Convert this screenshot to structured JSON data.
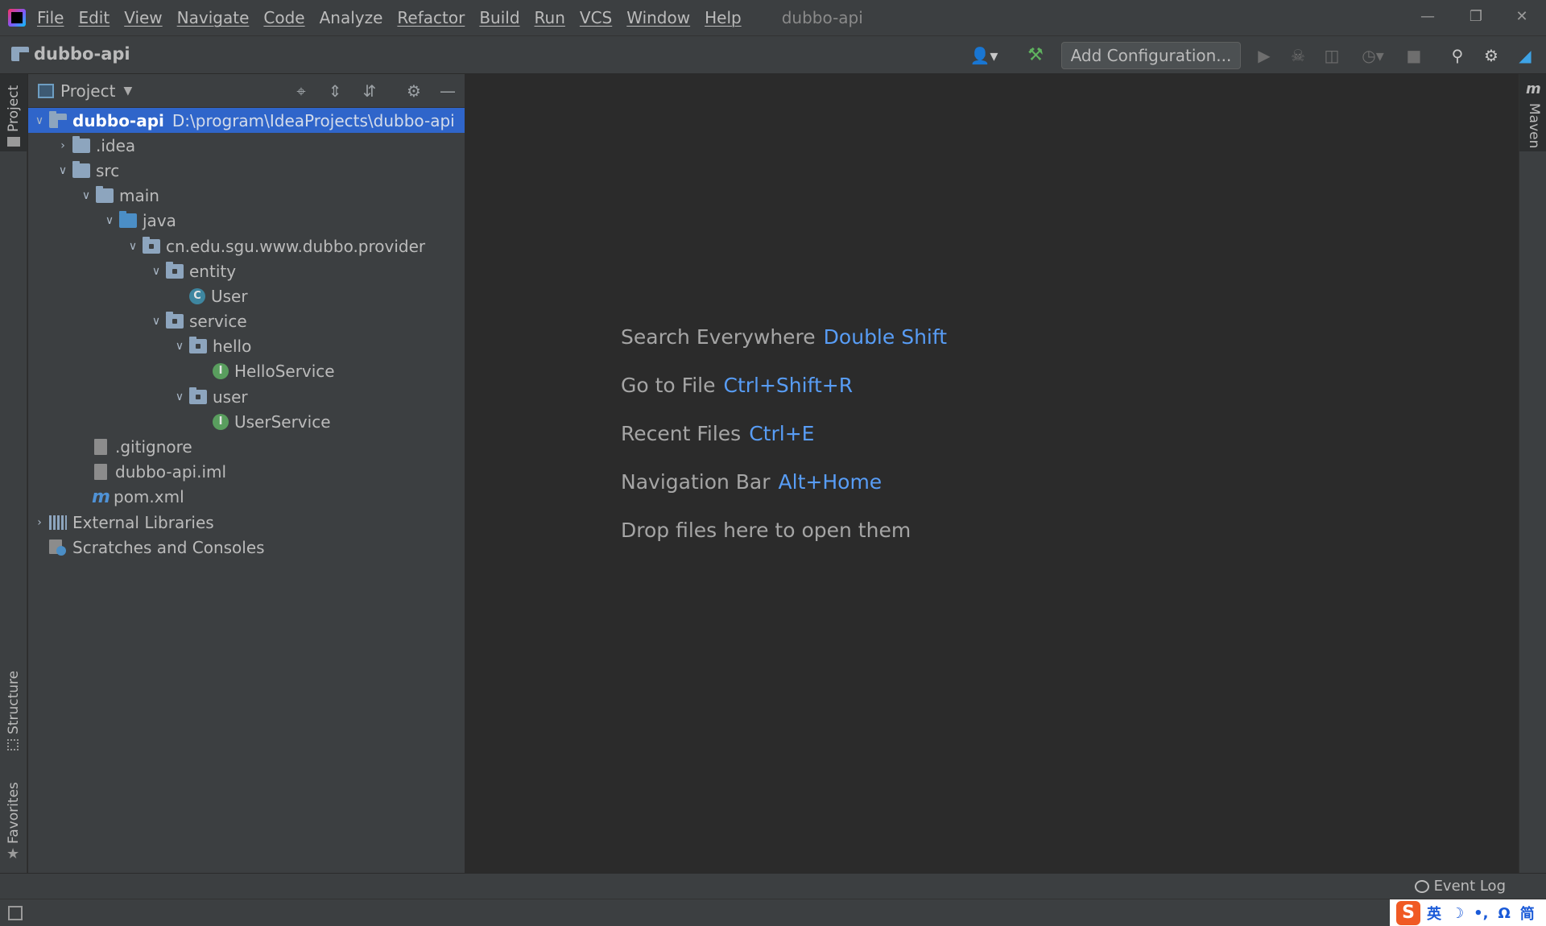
{
  "menu": {
    "items": [
      "File",
      "Edit",
      "View",
      "Navigate",
      "Code",
      "Analyze",
      "Refactor",
      "Build",
      "Run",
      "VCS",
      "Window",
      "Help"
    ],
    "window_title": "dubbo-api"
  },
  "toolbar": {
    "project_name": "dubbo-api",
    "add_configuration_label": "Add Configuration..."
  },
  "left_stripe": {
    "project_tab": "Project",
    "structure_tab": "Structure",
    "favorites_tab": "Favorites"
  },
  "right_stripe": {
    "maven_tab": "Maven"
  },
  "project_panel": {
    "title": "Project",
    "tree": [
      {
        "name": "dubbo-api",
        "path": "D:\\program\\IdeaProjects\\dubbo-api"
      },
      {
        "name": ".idea"
      },
      {
        "name": "src"
      },
      {
        "name": "main"
      },
      {
        "name": "java"
      },
      {
        "name": "cn.edu.sgu.www.dubbo.provider"
      },
      {
        "name": "entity"
      },
      {
        "name": "User"
      },
      {
        "name": "service"
      },
      {
        "name": "hello"
      },
      {
        "name": "HelloService"
      },
      {
        "name": "user"
      },
      {
        "name": "UserService"
      },
      {
        "name": ".gitignore"
      },
      {
        "name": "dubbo-api.iml"
      },
      {
        "name": "pom.xml"
      },
      {
        "name": "External Libraries"
      },
      {
        "name": "Scratches and Consoles"
      }
    ]
  },
  "editor_hints": [
    {
      "label": "Search Everywhere",
      "key": "Double Shift"
    },
    {
      "label": "Go to File",
      "key": "Ctrl+Shift+R"
    },
    {
      "label": "Recent Files",
      "key": "Ctrl+E"
    },
    {
      "label": "Navigation Bar",
      "key": "Alt+Home"
    },
    {
      "label": "Drop files here to open them",
      "key": ""
    }
  ],
  "bottom": {
    "event_log": "Event Log"
  },
  "ime": {
    "logo": "S",
    "lang": "英",
    "items": [
      "☽",
      "•,",
      "Ω",
      "简"
    ]
  },
  "colors": {
    "accent_blue": "#589df6",
    "selection": "#2f65ca",
    "background": "#2b2b2b",
    "panel": "#3c3f41"
  }
}
